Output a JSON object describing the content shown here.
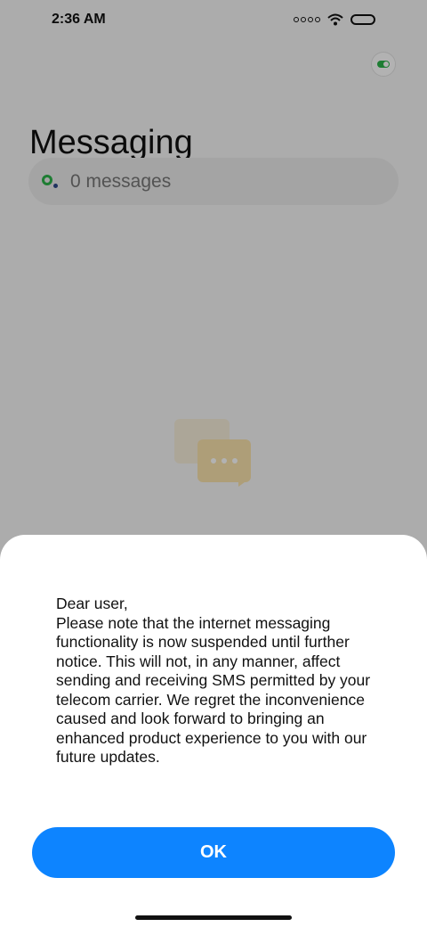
{
  "status_bar": {
    "time": "2:36 AM"
  },
  "header": {
    "title": "Messaging"
  },
  "search": {
    "text": "0 messages"
  },
  "dialog": {
    "message": "Dear user,\nPlease note that the internet messaging functionality is now suspended until further notice. This will not, in any manner, affect sending and receiving SMS permitted by your telecom carrier. We regret the inconvenience caused and look forward to bringing an enhanced product experience to you with our future updates.",
    "ok_label": "OK"
  },
  "colors": {
    "accent": "#0d84ff",
    "toggle_green": "#2bb34a"
  },
  "icons": {
    "signal": "signal-icon",
    "wifi": "wifi-icon",
    "battery": "battery-icon",
    "toggle": "toggle-icon",
    "search": "search-icon",
    "empty": "chat-bubbles-icon"
  }
}
